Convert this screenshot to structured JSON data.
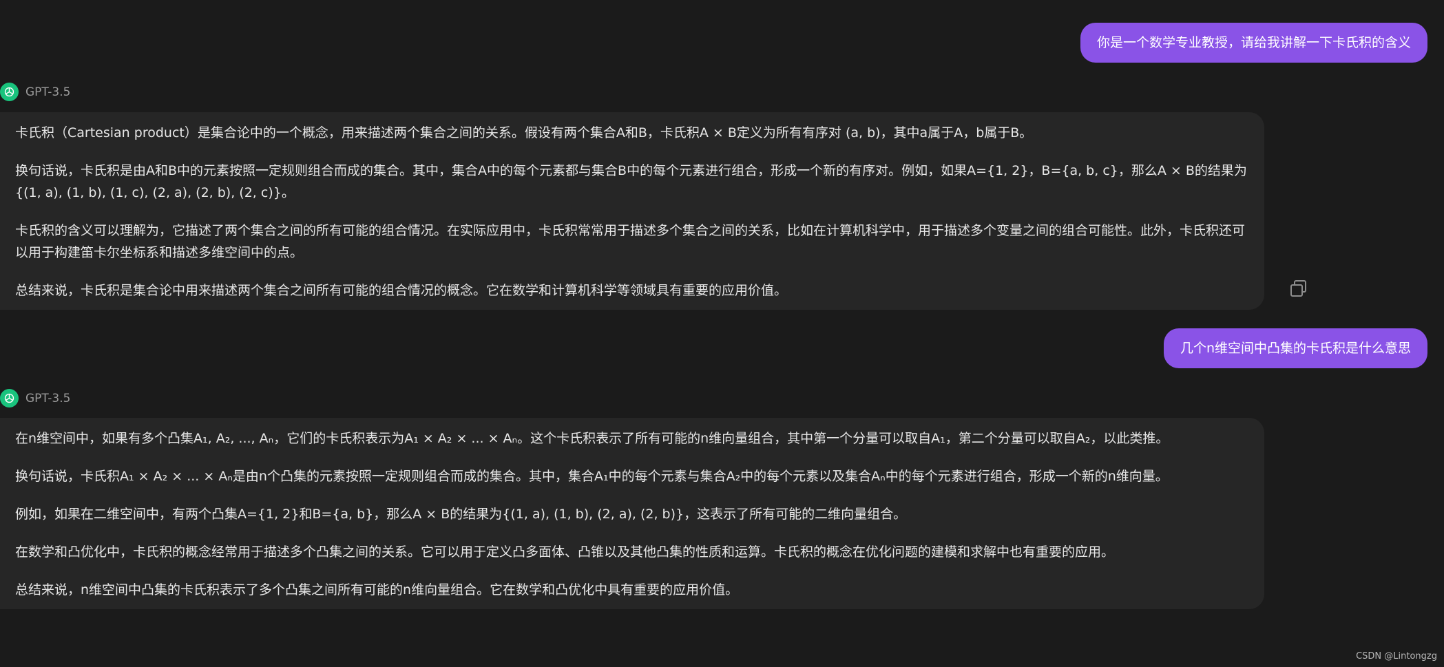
{
  "conversation": {
    "turns": [
      {
        "role": "user",
        "text": "你是一个数学专业教授，请给我讲解一下卡氏积的含义"
      },
      {
        "role": "assistant",
        "model": "GPT-3.5",
        "paragraphs": [
          "卡氏积（Cartesian product）是集合论中的一个概念，用来描述两个集合之间的关系。假设有两个集合A和B，卡氏积A × B定义为所有有序对 (a, b)，其中a属于A，b属于B。",
          "换句话说，卡氏积是由A和B中的元素按照一定规则组合而成的集合。其中，集合A中的每个元素都与集合B中的每个元素进行组合，形成一个新的有序对。例如，如果A={1, 2}，B={a, b, c}，那么A × B的结果为{(1, a), (1, b), (1, c), (2, a), (2, b), (2, c)}。",
          "卡氏积的含义可以理解为，它描述了两个集合之间的所有可能的组合情况。在实际应用中，卡氏积常常用于描述多个集合之间的关系，比如在计算机科学中，用于描述多个变量之间的组合可能性。此外，卡氏积还可以用于构建笛卡尔坐标系和描述多维空间中的点。",
          "总结来说，卡氏积是集合论中用来描述两个集合之间所有可能的组合情况的概念。它在数学和计算机科学等领域具有重要的应用价值。"
        ]
      },
      {
        "role": "user",
        "text": "几个n维空间中凸集的卡氏积是什么意思"
      },
      {
        "role": "assistant",
        "model": "GPT-3.5",
        "paragraphs": [
          "在n维空间中，如果有多个凸集A₁, A₂, ..., Aₙ，它们的卡氏积表示为A₁ × A₂ × ... × Aₙ。这个卡氏积表示了所有可能的n维向量组合，其中第一个分量可以取自A₁，第二个分量可以取自A₂，以此类推。",
          "换句话说，卡氏积A₁ × A₂ × ... × Aₙ是由n个凸集的元素按照一定规则组合而成的集合。其中，集合A₁中的每个元素与集合A₂中的每个元素以及集合Aₙ中的每个元素进行组合，形成一个新的n维向量。",
          "例如，如果在二维空间中，有两个凸集A={1, 2}和B={a, b}，那么A × B的结果为{(1, a), (1, b), (2, a), (2, b)}，这表示了所有可能的二维向量组合。",
          "在数学和凸优化中，卡氏积的概念经常用于描述多个凸集之间的关系。它可以用于定义凸多面体、凸锥以及其他凸集的性质和运算。卡氏积的概念在优化问题的建模和求解中也有重要的应用。",
          "总结来说，n维空间中凸集的卡氏积表示了多个凸集之间所有可能的n维向量组合。它在数学和凸优化中具有重要的应用价值。"
        ]
      }
    ]
  },
  "icons": {
    "avatar": "openai-logo-icon",
    "copy": "copy-icon"
  },
  "colors": {
    "background": "#1b1b1b",
    "card": "#262626",
    "user_bubble": "#8a53e7",
    "avatar": "#19c37d"
  },
  "footer": {
    "credit": "CSDN @Lintongzg"
  }
}
